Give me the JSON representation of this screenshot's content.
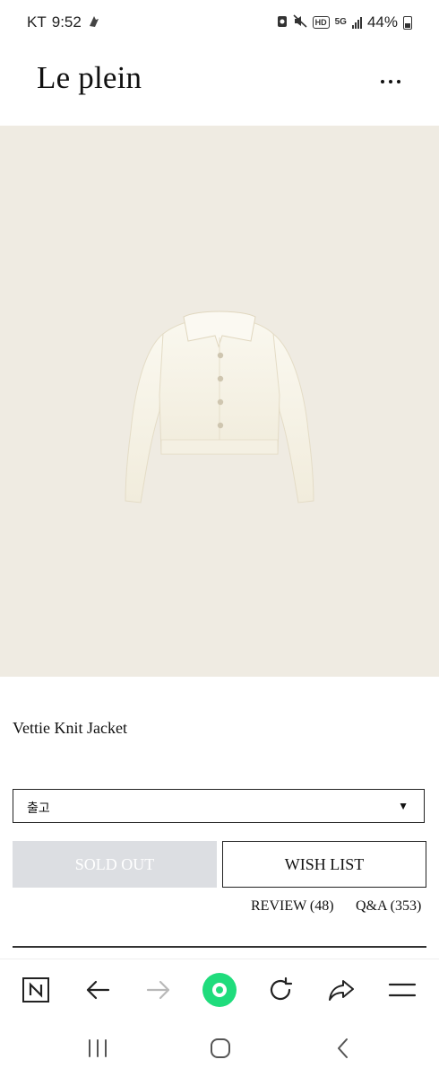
{
  "status_bar": {
    "carrier": "KT",
    "time": "9:52",
    "hd_label": "HD",
    "network_label": "5G",
    "battery": "44%"
  },
  "header": {
    "brand": "Le plein"
  },
  "product": {
    "name": "Vettie Knit Jacket",
    "option_value": "출고",
    "sold_out_label": "SOLD OUT",
    "wish_list_label": "WISH LIST",
    "review_label": "REVIEW (48)",
    "qa_label": "Q&A (353)"
  },
  "browser_bar": {
    "items": [
      "naver-home",
      "back",
      "forward",
      "green-dot",
      "reload",
      "share",
      "menu"
    ]
  },
  "system_nav": {
    "items": [
      "recents",
      "home",
      "back"
    ]
  },
  "colors": {
    "image_background": "#efebe2",
    "sold_out_bg": "#dcdee2",
    "accent_green": "#1fdc7c"
  }
}
